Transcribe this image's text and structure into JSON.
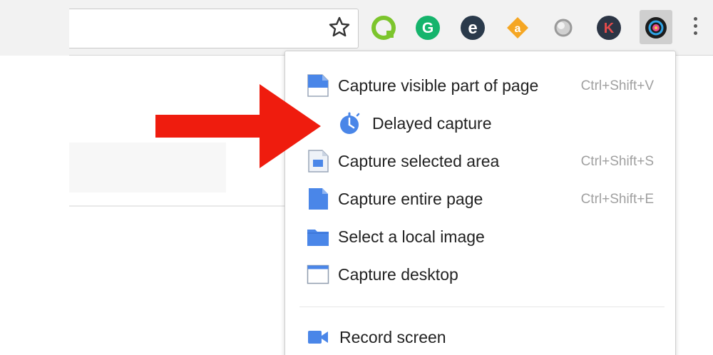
{
  "toolbar": {
    "bookmark_icon": "star-outline-icon",
    "extensions": [
      {
        "name": "quip-extension-icon",
        "color": "#7cc52c",
        "glyph": "Q"
      },
      {
        "name": "grammarly-extension-icon",
        "color": "#15b46c",
        "glyph": "G"
      },
      {
        "name": "evernote-extension-icon",
        "color": "#2a3a4b",
        "glyph": "e"
      },
      {
        "name": "amazon-assistant-extension-icon",
        "color": "#f5a623",
        "glyph": "a"
      },
      {
        "name": "gray-circle-extension-icon",
        "color": "#b8b8b8",
        "glyph": ""
      },
      {
        "name": "k-extension-icon",
        "color": "#2c3545",
        "glyph": "K"
      },
      {
        "name": "screenshot-extension-icon",
        "color": "#222222",
        "glyph": ""
      }
    ],
    "menu_icon": "kebab-menu-icon"
  },
  "menu": {
    "items": [
      {
        "label": "Capture visible part of page",
        "shortcut": "Ctrl+Shift+V",
        "icon": "capture-visible-icon"
      },
      {
        "label": "Delayed capture",
        "shortcut": "",
        "icon": "timer-icon"
      },
      {
        "label": "Capture selected area",
        "shortcut": "Ctrl+Shift+S",
        "icon": "capture-selected-icon"
      },
      {
        "label": "Capture entire page",
        "shortcut": "Ctrl+Shift+E",
        "icon": "capture-entire-icon"
      },
      {
        "label": "Select a local image",
        "shortcut": "",
        "icon": "folder-icon"
      },
      {
        "label": "Capture desktop",
        "shortcut": "",
        "icon": "desktop-window-icon"
      },
      {
        "label": "Record screen",
        "shortcut": "",
        "icon": "video-camera-icon"
      }
    ]
  },
  "annotation": {
    "arrow_color": "#ef1c0e",
    "arrow_icon": "red-arrow-pointer"
  },
  "colors": {
    "accent_blue": "#4a86e8",
    "toolbar_bg": "#f2f2f2",
    "shortcut_gray": "#a0a0a0"
  }
}
